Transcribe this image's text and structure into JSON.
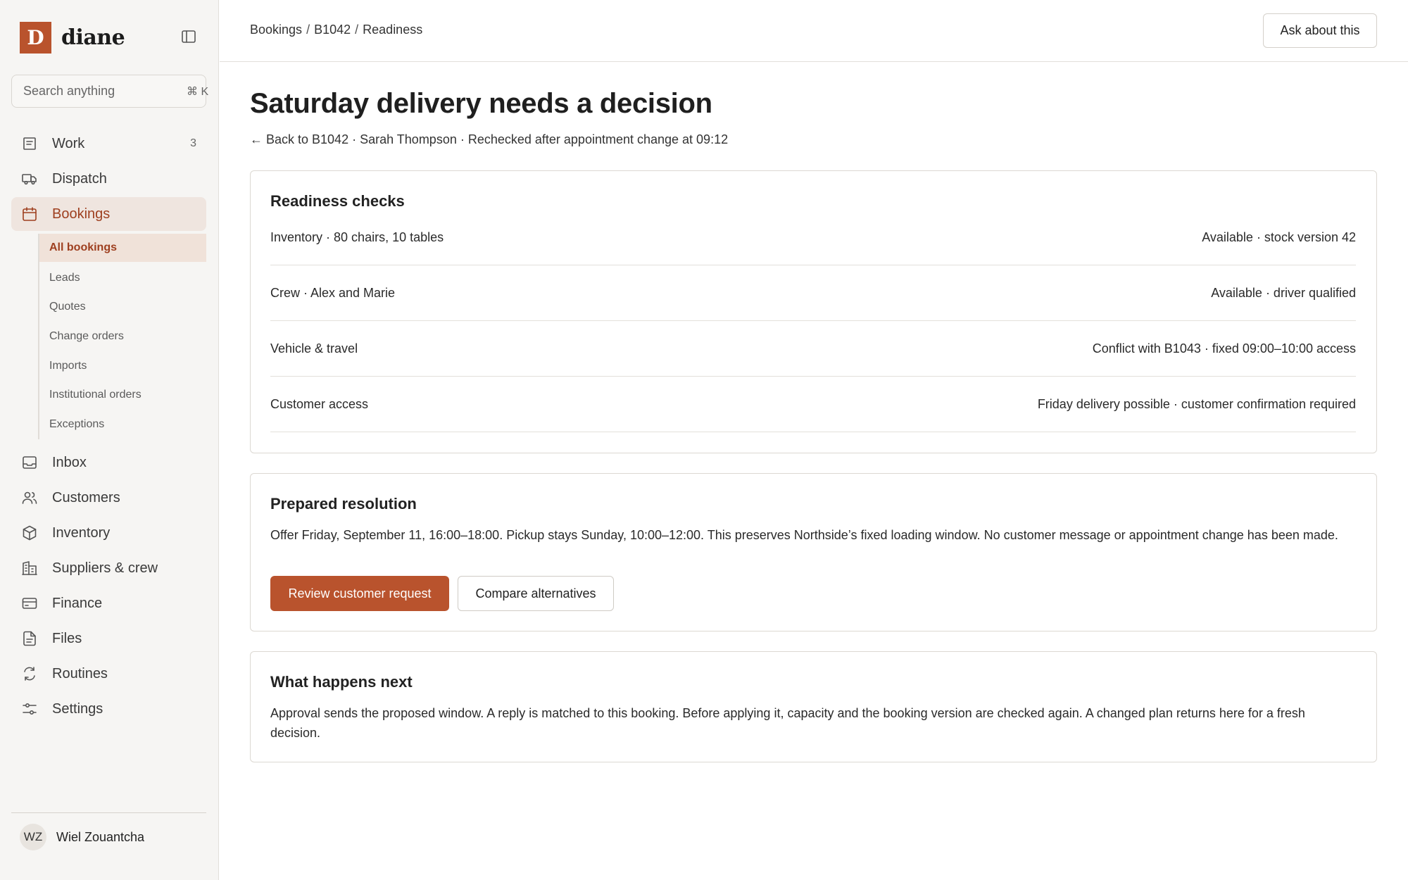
{
  "brand": {
    "logo_letter": "D",
    "name": "diane"
  },
  "search": {
    "placeholder": "Search anything",
    "shortcut": "⌘ K"
  },
  "nav": {
    "items": [
      {
        "label": "Work",
        "icon": "list-icon",
        "count": "3"
      },
      {
        "label": "Dispatch",
        "icon": "truck-icon"
      },
      {
        "label": "Bookings",
        "icon": "calendar-icon",
        "active": true
      },
      {
        "label": "Inbox",
        "icon": "inbox-icon"
      },
      {
        "label": "Customers",
        "icon": "users-icon"
      },
      {
        "label": "Inventory",
        "icon": "box-icon"
      },
      {
        "label": "Suppliers & crew",
        "icon": "building-icon"
      },
      {
        "label": "Finance",
        "icon": "card-icon"
      },
      {
        "label": "Files",
        "icon": "file-icon"
      },
      {
        "label": "Routines",
        "icon": "routine-icon"
      },
      {
        "label": "Settings",
        "icon": "sliders-icon"
      }
    ],
    "bookings_sub": [
      {
        "label": "All bookings",
        "active": true
      },
      {
        "label": "Leads"
      },
      {
        "label": "Quotes"
      },
      {
        "label": "Change orders"
      },
      {
        "label": "Imports"
      },
      {
        "label": "Institutional orders"
      },
      {
        "label": "Exceptions"
      }
    ]
  },
  "user": {
    "initials": "WZ",
    "name": "Wiel Zouantcha"
  },
  "header": {
    "breadcrumb": [
      "Bookings",
      "B1042",
      "Readiness"
    ],
    "breadcrumb_sep": "/",
    "ask_label": "Ask about this"
  },
  "page": {
    "title": "Saturday delivery needs a decision",
    "back_link": "← Back to B1042",
    "subline_rest": " · Sarah Thompson · Rechecked after appointment change at 09:12"
  },
  "readiness": {
    "title": "Readiness checks",
    "rows": [
      {
        "label": "Inventory · 80 chairs, 10 tables",
        "status": "Available · stock version 42"
      },
      {
        "label": "Crew · Alex and Marie",
        "status": "Available · driver qualified"
      },
      {
        "label": "Vehicle & travel",
        "status": "Conflict with B1043 · fixed 09:00–10:00 access"
      },
      {
        "label": "Customer access",
        "status": "Friday delivery possible · customer confirmation required"
      }
    ]
  },
  "resolution": {
    "title": "Prepared resolution",
    "text": "Offer Friday, September 11, 16:00–18:00. Pickup stays Sunday, 10:00–12:00. This preserves Northside’s fixed loading window. No customer message or appointment change has been made.",
    "primary_label": "Review customer request",
    "secondary_label": "Compare alternatives"
  },
  "next": {
    "title": "What happens next",
    "text": "Approval sends the proposed window. A reply is matched to this booking. Before applying it, capacity and the booking version are checked again. A changed plan returns here for a fresh decision."
  },
  "colors": {
    "accent": "#b9532d",
    "accent_text": "#9e3f1f",
    "active_bg": "#efe5df",
    "sidebar_bg": "#f6f5f3"
  }
}
